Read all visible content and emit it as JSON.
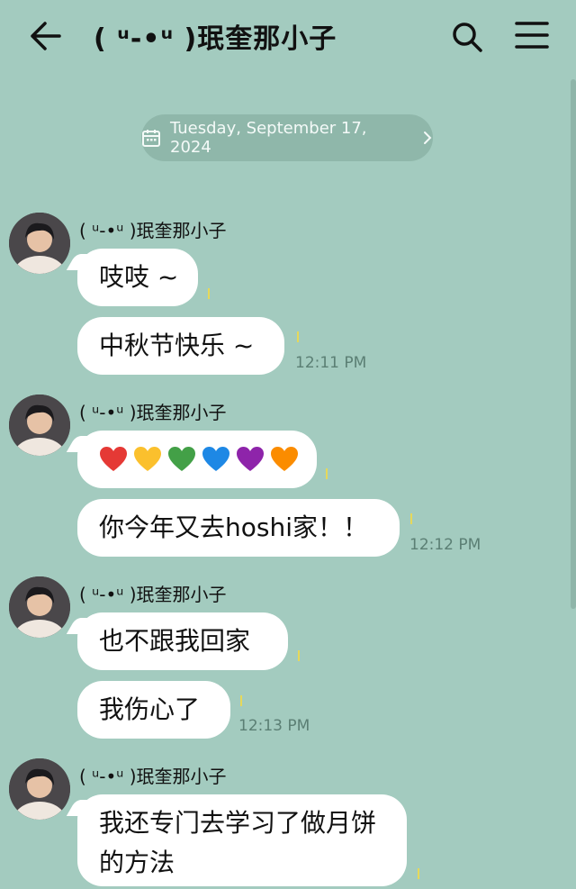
{
  "header": {
    "title": "( ᵘ-•ᵘ )珉奎那小子"
  },
  "date_pill": {
    "label": "Tuesday, September 17, 2024"
  },
  "messages": [
    {
      "sender": "( ᵘ-•ᵘ )珉奎那小子",
      "text": "吱吱 ~"
    },
    {
      "text": "中秋节快乐 ~",
      "time": "12:11 PM"
    },
    {
      "sender": "( ᵘ-•ᵘ )珉奎那小子",
      "hearts": [
        "#e53935",
        "#fbc02d",
        "#43a047",
        "#1e88e5",
        "#8e24aa",
        "#fb8c00"
      ]
    },
    {
      "text": "你今年又去hoshi家！！",
      "time": "12:12 PM"
    },
    {
      "sender": "( ᵘ-•ᵘ )珉奎那小子",
      "text": "也不跟我回家"
    },
    {
      "text": "我伤心了",
      "time": "12:13 PM"
    },
    {
      "sender": "( ᵘ-•ᵘ )珉奎那小子",
      "text": "我还专门去学习了做月饼的方法"
    }
  ],
  "icons": {
    "back": "arrow-left-icon",
    "search": "search-icon",
    "menu": "hamburger-menu-icon",
    "calendar": "calendar-icon",
    "chevron": "chevron-right-icon"
  }
}
